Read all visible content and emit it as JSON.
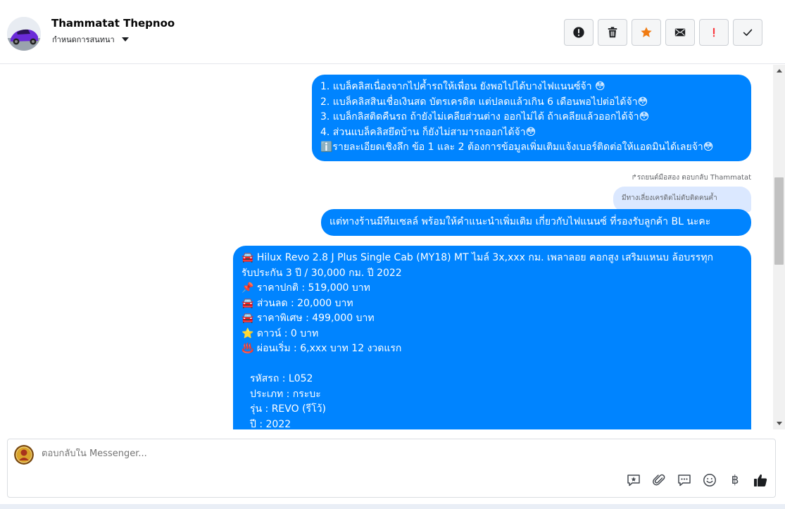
{
  "header": {
    "contact_name": "Thammatat Thepnoo",
    "assign_label": "กำหนดการสนทนา",
    "toolbar": [
      {
        "name": "mark-spam-button",
        "icon": "exclamation-circle-icon",
        "color": "#1c1e21"
      },
      {
        "name": "delete-button",
        "icon": "trash-icon",
        "color": "#1c1e21"
      },
      {
        "name": "star-button",
        "icon": "star-icon",
        "color": "#f07b12"
      },
      {
        "name": "mark-unread-button",
        "icon": "envelope-icon",
        "color": "#1c1e21"
      },
      {
        "name": "follow-up-button",
        "icon": "exclamation-icon",
        "color": "#fa383e"
      },
      {
        "name": "mark-done-button",
        "icon": "checkmark-icon",
        "color": "#1c1e21"
      }
    ]
  },
  "messages": {
    "m1": {
      "lines": [
        "1. แบล็คลิสเนื่องจากไปค้ำรถให้เพื่อน ยังพอไปได้บางไฟแนนซ์จ้า 😳",
        "2. แบล็คลิสสินเชื่อเงินสด บัตรเครดิต แต่ปลดแล้วเกิน 6 เดือนพอไปต่อได้จ้า😳",
        "3. แบล็กลิสติดคืนรถ ถ้ายังไม่เคลียส่วนต่าง ออกไม่ได้ ถ้าเคลียแล้วออกได้จ้า😳",
        "4. ส่วนแบล็คลิสยึดบ้าน ก็ยังไม่สามารถออกได้จ้า😳",
        "ℹ️รายละเอียดเชิงลึก ข้อ 1 และ 2 ต้องการข้อมูลเพิ่มเติมแจ้งเบอร์ติดต่อให้แอดมินได้เลยจ้า😳"
      ]
    },
    "reply_meta": "↱รถยนต์มือสอง ตอบกลับ Thammatat",
    "quoted_text": "มีทางเลี่ยงเครดิตไม่ดับติดคนค้ำ",
    "m2": "แต่ทางร้านมีทีมเซลล์ พร้อมให้คำแนะนำเพิ่มเติม เกี่ยวกับไฟแนนซ์ ที่รองรับลูกค้า BL นะคะ",
    "m3": {
      "title_line1": "🚘 Hilux Revo 2.8 J Plus Single Cab (MY18) MT ไมล์ 3x,xxx กม. เพลาลอย คอกสูง เสริมแหนบ ล้อบรรทุก",
      "title_line2": "รับประกัน 3 ปี / 30,000 กม. ปี 2022",
      "price_lines": [
        "📌 ราคาปกติ : 519,000 บาท",
        "🚘 ส่วนลด : 20,000 บาท",
        "🚘 ราคาพิเศษ : 499,000 บาท",
        "⭐ ดาวน์ : 0 บาท",
        "♨️ ผ่อนเริ่ม : 6,xxx บาท 12 งวดแรก"
      ],
      "detail_lines": [
        "รหัสรถ : L052",
        "ประเภท : กระบะ",
        "รุ่น : REVO (รีโว้)",
        "ปี : 2022"
      ]
    }
  },
  "composer": {
    "placeholder": "ตอบกลับใน Messenger...",
    "actions": [
      "saved-reply-icon",
      "attachment-icon",
      "chat-bubble-icon",
      "emoji-icon",
      "baht-icon",
      "like-icon"
    ],
    "baht_symbol": "฿"
  },
  "colors": {
    "bubble": "#0084ff",
    "quoted_bubble": "#dbe8ff",
    "star": "#f07b12",
    "follow_up": "#fa383e"
  }
}
